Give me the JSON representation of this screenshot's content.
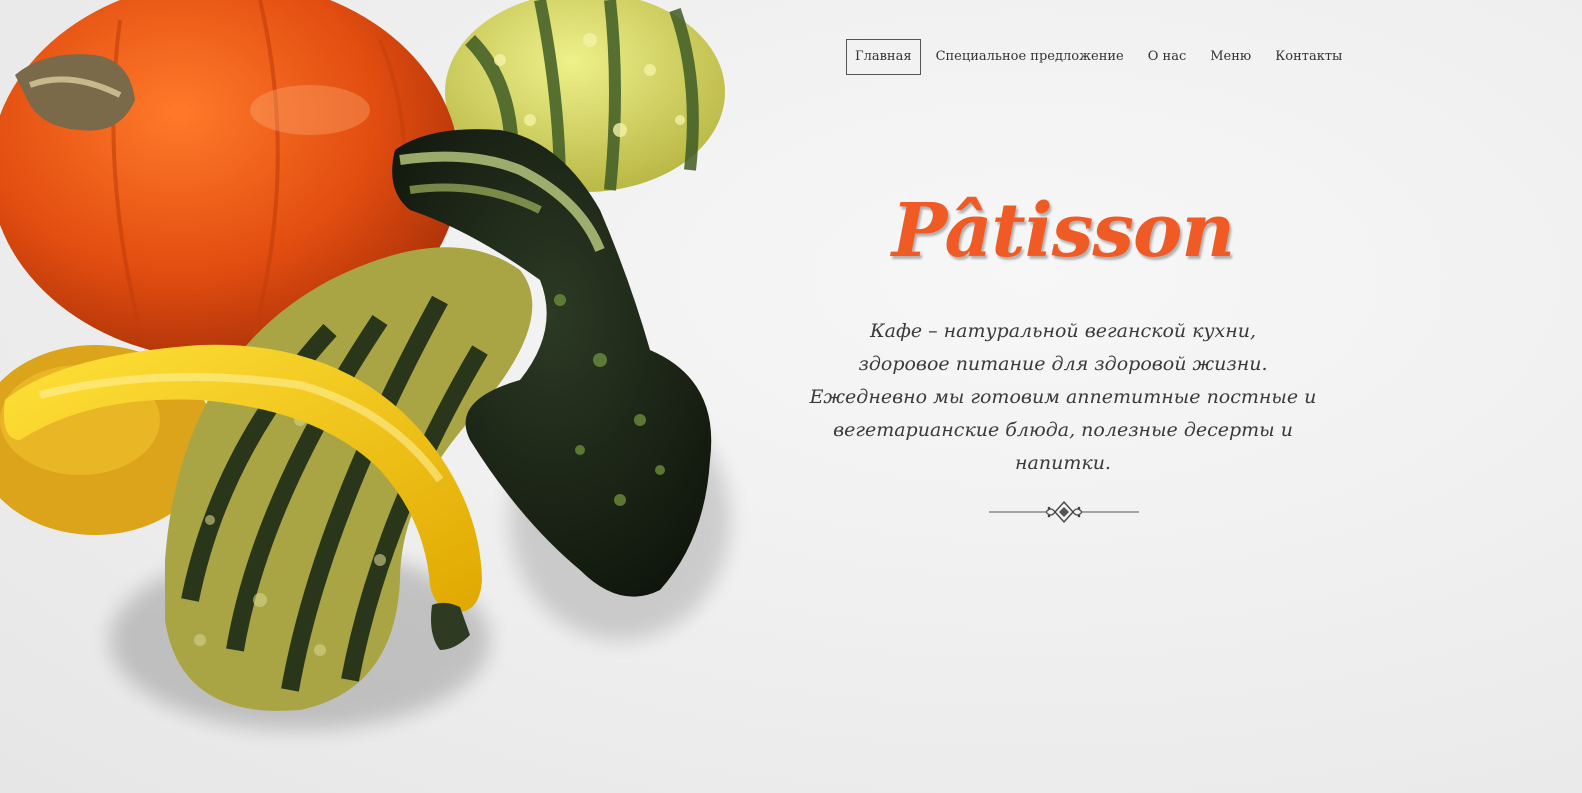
{
  "nav": {
    "items": [
      {
        "label": "Главная",
        "active": true
      },
      {
        "label": "Специальное предложение",
        "active": false
      },
      {
        "label": "О нас",
        "active": false
      },
      {
        "label": "Меню",
        "active": false
      },
      {
        "label": "Контакты",
        "active": false
      }
    ]
  },
  "hero": {
    "brand": "Pâtisson",
    "description_lines": [
      "Кафе – натуральной веганской кухни,",
      "здоровое питание для здоровой жизни.",
      "Ежедневно мы готовим аппетитные постные и",
      "вегетарианские блюда, полезные десерты и",
      "напитки."
    ],
    "image_icon": "squash-photo",
    "divider_icon": "ornament-divider-icon"
  },
  "colors": {
    "brand": "#f05a24",
    "text": "#3a3a3a",
    "background": "#ededed"
  }
}
